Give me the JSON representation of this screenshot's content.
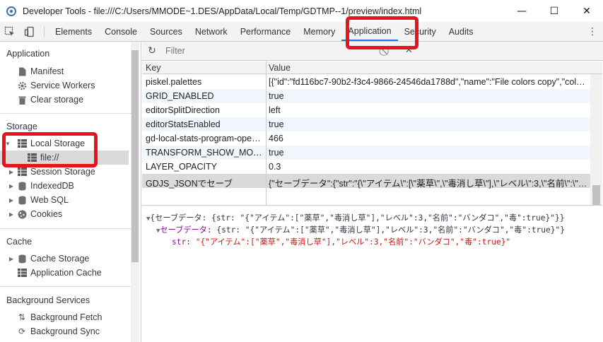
{
  "window": {
    "title": "Developer Tools - file:///C:/Users/MMODE~1.DES/AppData/Local/Temp/GDTMP--1/preview/index.html",
    "minimize": "—",
    "maximize": "☐",
    "close": "✕"
  },
  "tabs": [
    "Elements",
    "Console",
    "Sources",
    "Network",
    "Performance",
    "Memory",
    "Application",
    "Security",
    "Audits"
  ],
  "active_tab": "Application",
  "sidebar": {
    "application_header": "Application",
    "application_items": [
      "Manifest",
      "Service Workers",
      "Clear storage"
    ],
    "storage_header": "Storage",
    "storage_items": {
      "local_storage": "Local Storage",
      "local_storage_child": "file://",
      "session_storage": "Session Storage",
      "indexeddb": "IndexedDB",
      "websql": "Web SQL",
      "cookies": "Cookies"
    },
    "cache_header": "Cache",
    "cache_items": [
      "Cache Storage",
      "Application Cache"
    ],
    "background_header": "Background Services",
    "background_items": [
      "Background Fetch",
      "Background Sync"
    ]
  },
  "filter": {
    "placeholder": "Filter"
  },
  "grid": {
    "key_header": "Key",
    "value_header": "Value",
    "rows": [
      {
        "key": "piskel.palettes",
        "value": "[{\"id\":\"fd116bc7-90b2-f3c4-9866-24546da1788d\",\"name\":\"File colors copy\",\"colors\":[…"
      },
      {
        "key": "GRID_ENABLED",
        "value": "true"
      },
      {
        "key": "editorSplitDirection",
        "value": "left"
      },
      {
        "key": "editorStatsEnabled",
        "value": "true"
      },
      {
        "key": "gd-local-stats-program-open…",
        "value": "466"
      },
      {
        "key": "TRANSFORM_SHOW_MORE",
        "value": "true"
      },
      {
        "key": "LAYER_OPACITY",
        "value": "0.3"
      },
      {
        "key": "GDJS_JSONでセーブ",
        "value": "{\"セーブデータ\":{\"str\":\"{\\\"アイテム\\\":[\\\"薬草\\\",\\\"毒消し草\\\"],\\\"レベル\\\":3,\\\"名前\\\":\\\"…"
      }
    ]
  },
  "preview": {
    "line1": "{セーブデータ: {str: \"{\"アイテム\":[\"薬草\",\"毒消し草\"],\"レベル\":3,\"名前\":\"バンダコ\",\"毒\":true}\"}}",
    "line2_key": "セーブデータ",
    "line2_rest": ": {str: \"{\"アイテム\":[\"薬草\",\"毒消し草\"],\"レベル\":3,\"名前\":\"バンダコ\",\"毒\":true}\"}",
    "line3_key": "str",
    "line3_value": "\"{\"アイテム\":[\"薬草\",\"毒消し草\"],\"レベル\":3,\"名前\":\"バンダコ\",\"毒\":true}\""
  },
  "colors": {
    "annotation": "#e8131b",
    "active_tab_underline": "#1a73e8"
  }
}
